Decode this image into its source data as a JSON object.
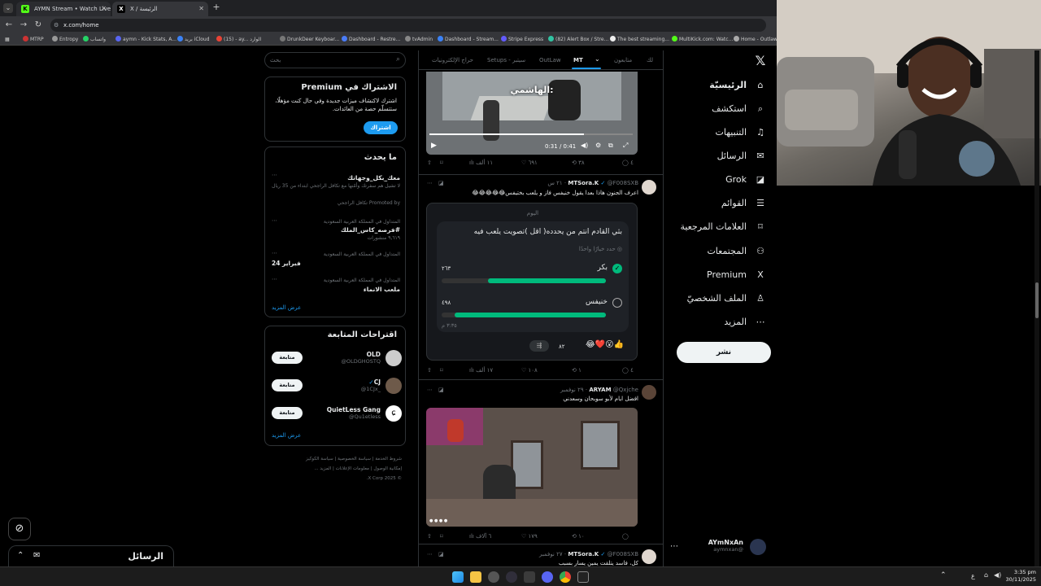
{
  "browser": {
    "tabs": [
      {
        "title": "AYMN Stream • Watch Live on K",
        "icon": "K"
      },
      {
        "title": "X / الرئيسة",
        "icon": "X"
      }
    ],
    "url": "x.com/home",
    "bookmarks": [
      "MTRP",
      "Entropy",
      "واتساب",
      "aymn - Kick Stats, A...",
      "بريد iCloud",
      "(15) - ay... الوارد",
      "DrunkDeer Keyboar...",
      "Dashboard - Restre...",
      "tvAdmin",
      "Dashboard - Stream...",
      "Stripe Express",
      "(82) Alert Box / Stre...",
      "The best streaming...",
      "MultiKick.com: Watc...",
      "Home - Outlaw"
    ]
  },
  "x_nav": {
    "items": [
      {
        "label": "الرئيسيّة",
        "icon": "home-icon",
        "glyph": "⌂"
      },
      {
        "label": "استكشف",
        "icon": "search-icon",
        "glyph": "⌕"
      },
      {
        "label": "التنبيهات",
        "icon": "bell-icon",
        "glyph": "♫"
      },
      {
        "label": "الرسائل",
        "icon": "mail-icon",
        "glyph": "✉"
      },
      {
        "label": "Grok",
        "icon": "grok-icon",
        "glyph": "◪"
      },
      {
        "label": "القوائم",
        "icon": "list-icon",
        "glyph": "☰"
      },
      {
        "label": "العلامات المرجعية",
        "icon": "bookmark-icon",
        "glyph": "⌑"
      },
      {
        "label": "المجتمعات",
        "icon": "communities-icon",
        "glyph": "⚇"
      },
      {
        "label": "Premium",
        "icon": "x-logo-icon",
        "glyph": "X"
      },
      {
        "label": "الملف الشخصيّ",
        "icon": "profile-icon",
        "glyph": "♙"
      },
      {
        "label": "المزيد",
        "icon": "more-icon",
        "glyph": "⋯"
      }
    ],
    "post_button": "نشر",
    "account": {
      "name": "AYmNxAn",
      "handle": "@aymnxan"
    }
  },
  "feed": {
    "tabs": [
      "لك",
      "متابعون",
      "MT",
      "OutLaw",
      "Setups - سيتبر",
      "حراج الإلكترونيات"
    ],
    "video1": {
      "caption": "الهاشمي:",
      "time": "0:31 / 0:41"
    },
    "tweet1_stats": {
      "replies": "٤",
      "retweets": "٣٨",
      "likes": "٦٩١",
      "views": "١١ ألف"
    },
    "tweet2": {
      "author": "MTSora.K",
      "handle": "@F008SXB",
      "time": "٢١ س",
      "text": "اعرف الجنون هاذا بعدا يقول خنيفس فاز و يلعب بختيفس😂😂😂😂😂",
      "poll": {
        "date": "اليوم",
        "question": "بثي القادم انتم من يحدده( اقل )تصويت يلعب فيه",
        "subtitle": "حدد خيارًا واحدًا",
        "options": [
          {
            "label": "بكر",
            "votes": "٢٦٣",
            "fraction": 0.72,
            "selected": true
          },
          {
            "label": "خنيفس",
            "votes": "٤٩٨",
            "fraction": 0.92,
            "selected": false
          }
        ],
        "time_left": "٣:٣٥ م",
        "reactions": "😂❤️😮👍",
        "reaction_count": "٨٢"
      },
      "stats": {
        "replies": "٤",
        "retweets": "١",
        "likes": "١٠٨",
        "views": "١٧ ألف"
      }
    },
    "tweet3": {
      "author": "ARYAM",
      "handle": "@Qxjche",
      "time": "٢٩ نوفمبر",
      "text": "افضل ايام لأبو سوبحان وسعدني",
      "stats": {
        "replies": "",
        "retweets": "١٠",
        "likes": "١٧٩",
        "views": "٦ آلاف"
      }
    },
    "tweet4": {
      "author": "MTSora.K",
      "handle": "@F008SXB",
      "time": "٢٧ نوفمبر",
      "text": "كل، فاسد يتلقت يمين يسار بسبب"
    }
  },
  "sidebar": {
    "search_placeholder": "بحث",
    "premium": {
      "title": "الاشتراك في Premium",
      "body": "اشترك لاكتشاف ميزات جديدة وفي حال كنت مؤهلًا، ستتسلّم حصة من العائدات.",
      "button": "اشتراك"
    },
    "trends": {
      "title": "ما يحدث",
      "items": [
        {
          "meta": "",
          "title": "معك_بكل_وجهاتك",
          "sub": "لا تشيل هم سفرتك وأمّنها مع تكافل الراجحي ابتداء من 35 ريال",
          "promo": "Promoted by تكافل الراجحي"
        },
        {
          "meta": "المتداول في المملكة العربية السعودية",
          "title": "#فرصه_كاس_الملك",
          "sub": "٩,٦١٩ منشورات"
        },
        {
          "meta": "المتداول في المملكة العربية السعودية",
          "title": "فبراير 24",
          "sub": ""
        },
        {
          "meta": "المتداول في المملكة العربية السعودية",
          "title": "ملعب الانماء",
          "sub": ""
        }
      ],
      "show_more": "عرض المزيد"
    },
    "follow": {
      "title": "اقتراحات المتابعة",
      "items": [
        {
          "name": "OLD",
          "handle": "@OLDGHOSTQ",
          "button": "متابعة"
        },
        {
          "name": "CJ",
          "handle": "@1CJx_",
          "button": "متابعة"
        },
        {
          "name": "QuietLess Gang",
          "handle": "@Qu1etless",
          "button": "متابعة"
        }
      ],
      "show_more": "عرض المزيد"
    },
    "footer": [
      "شروط الخدمة",
      "سياسة الخصوصية",
      "سياسة الكوكيز",
      "إمكانية الوصول",
      "معلومات الإعلانات",
      "المزيد ...",
      "© 2025 X Corp."
    ]
  },
  "messages_drawer": {
    "title": "الرسائل"
  },
  "taskbar": {
    "time": "3:35 pm",
    "date": "30/11/2025",
    "lang": "ع"
  },
  "colors": {
    "accent": "#1d9bf0",
    "poll_green": "#00ba7c",
    "background": "#000000"
  }
}
